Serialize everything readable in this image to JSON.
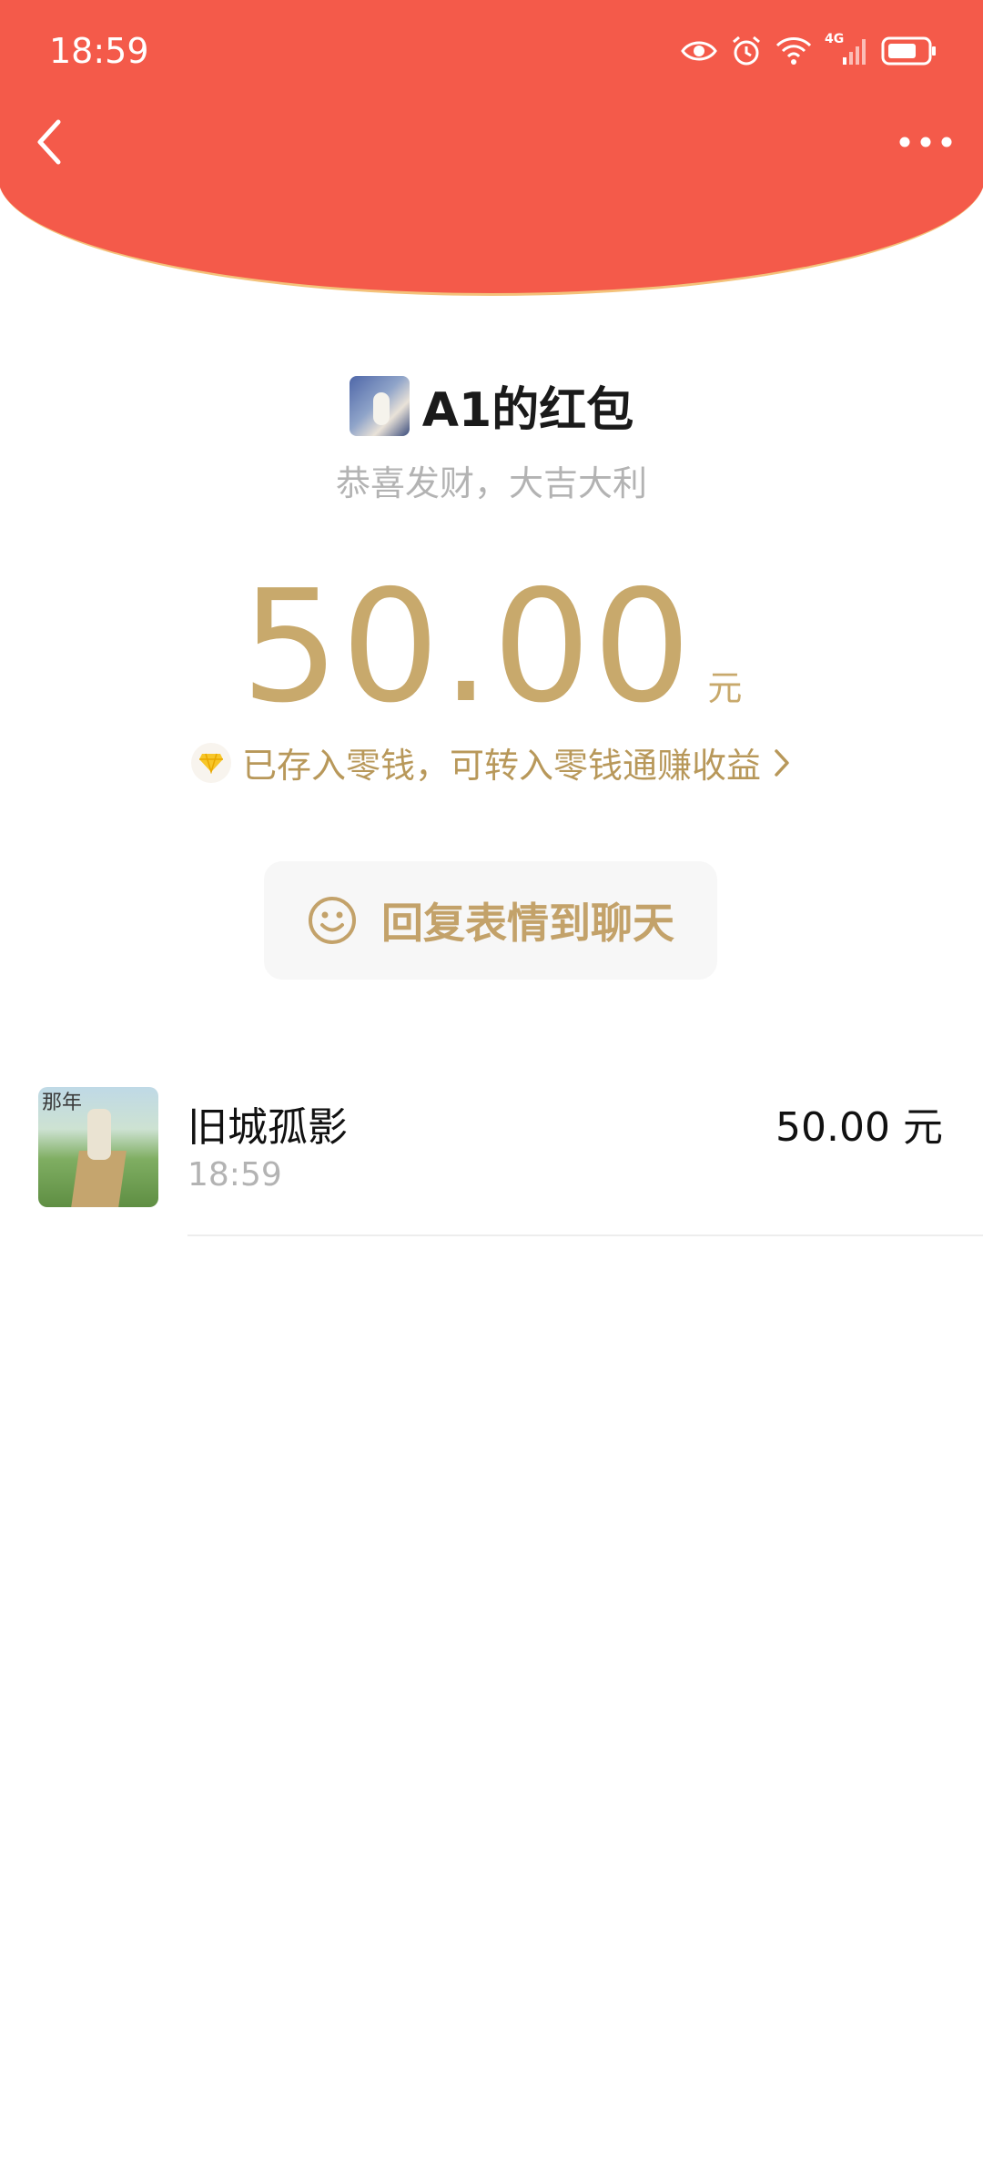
{
  "status_bar": {
    "time": "18:59",
    "network": "4G",
    "icons": [
      "eye-icon",
      "alarm-icon",
      "wifi-icon",
      "signal-icon",
      "battery-icon"
    ]
  },
  "nav": {
    "back_icon": "chevron-left-icon",
    "more_icon": "more-dots-icon"
  },
  "red_packet": {
    "sender_title": "A1的红包",
    "greeting": "恭喜发财，大吉大利",
    "amount": "50.00",
    "unit": "元",
    "stored_text": "已存入零钱，可转入零钱通赚收益",
    "reply_label": "回复表情到聊天"
  },
  "records": [
    {
      "name": "旧城孤影",
      "time": "18:59",
      "amount": "50.00 元",
      "thumb_text": "那年"
    }
  ],
  "colors": {
    "header_red": "#F45A4A",
    "gold": "#C8A96C",
    "arc_border": "#F4C27A"
  }
}
